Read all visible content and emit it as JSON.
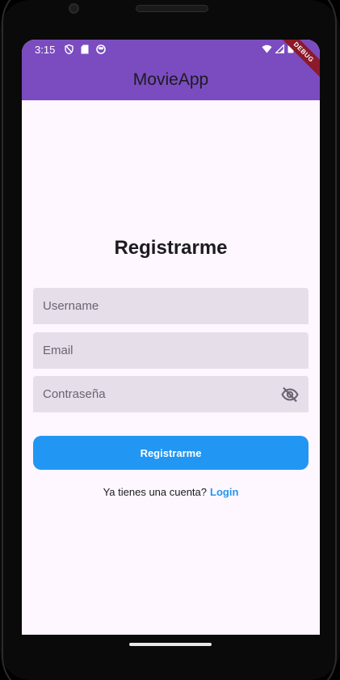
{
  "status_bar": {
    "time": "3:15",
    "icons": [
      "shield-icon",
      "sd-card-icon",
      "circle-face-icon",
      "wifi-icon",
      "signal-icon",
      "battery-icon"
    ]
  },
  "appbar": {
    "title": "MovieApp"
  },
  "debug_ribbon": "DEBUG",
  "form": {
    "title": "Registrarme",
    "username_placeholder": "Username",
    "email_placeholder": "Email",
    "password_placeholder": "Contraseña",
    "submit_label": "Registrarme",
    "has_account_text": "Ya tienes una cuenta?",
    "login_link": "Login"
  },
  "colors": {
    "appbar": "#7b4cc0",
    "background": "#fef7ff",
    "field": "#e6dfea",
    "primary_button": "#2196f3",
    "link": "#2196f3"
  }
}
